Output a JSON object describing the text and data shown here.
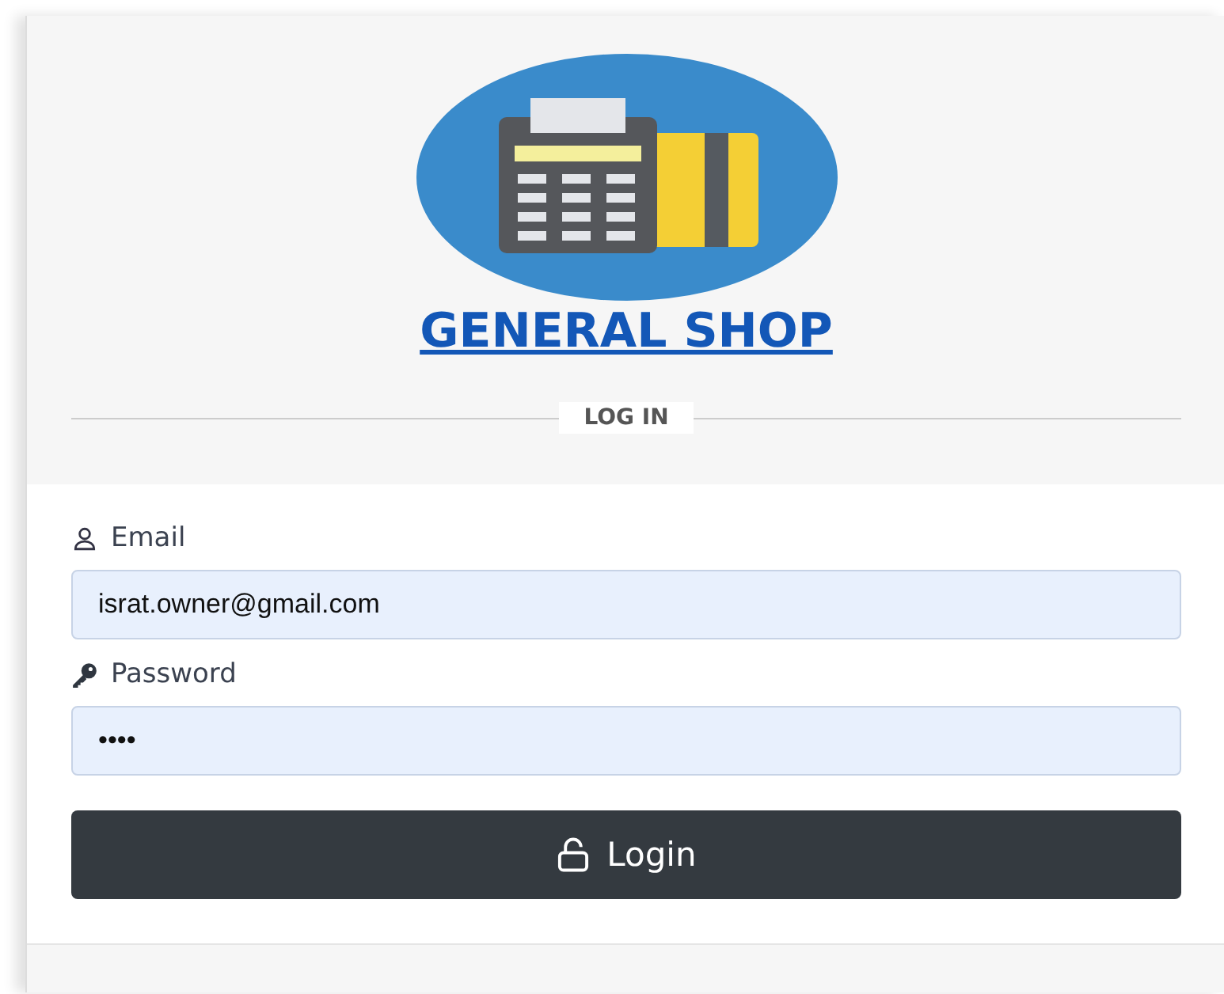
{
  "brand": {
    "title": "GENERAL SHOP"
  },
  "section_label": "LOG IN",
  "fields": [
    {
      "kind": "email",
      "label": "Email",
      "value": "israt.owner@gmail.com"
    },
    {
      "kind": "password",
      "label": "Password",
      "value": "••••"
    }
  ],
  "login_button": {
    "label": "Login"
  }
}
